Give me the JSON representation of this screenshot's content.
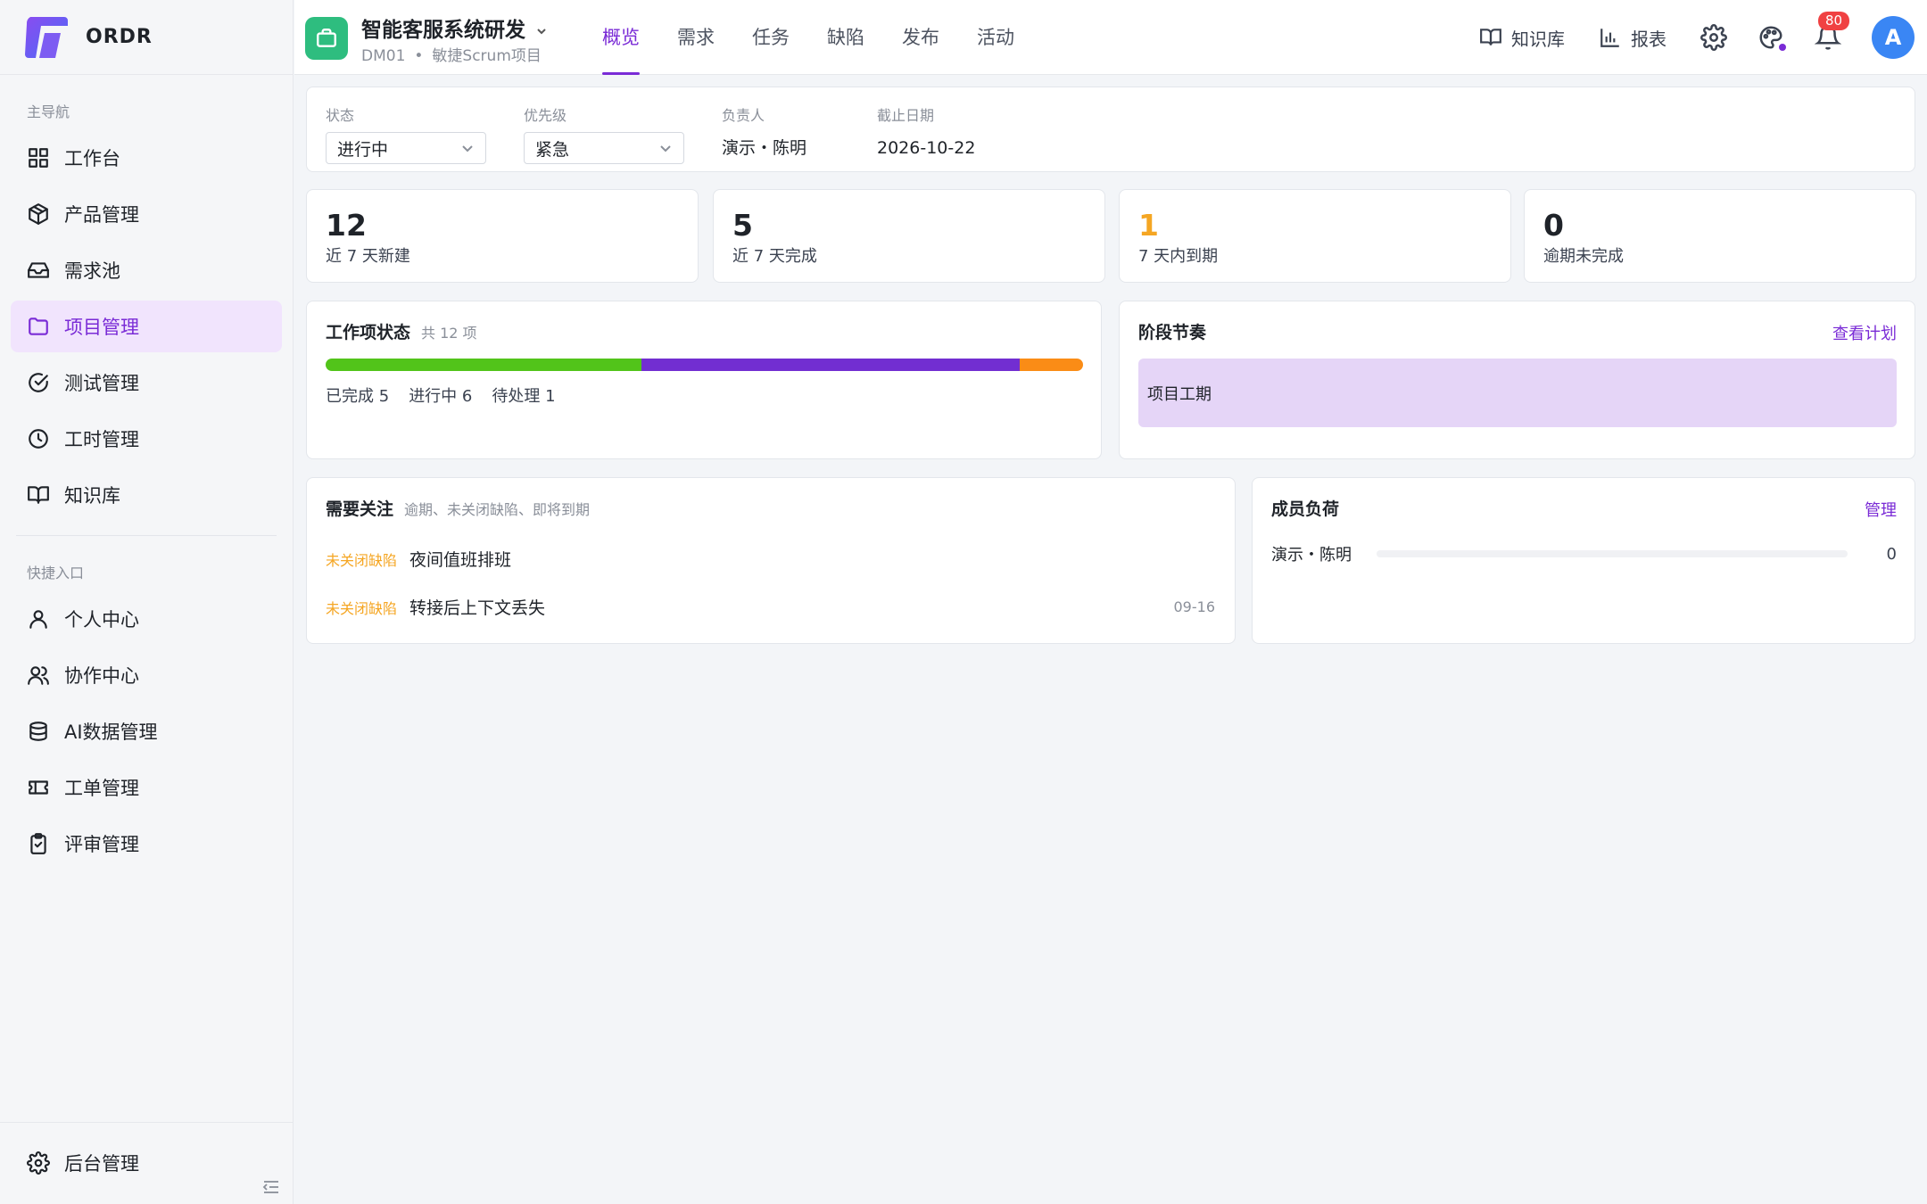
{
  "brand": {
    "name": "ORDR"
  },
  "sidebar": {
    "main_title": "主导航",
    "main_items": [
      {
        "label": "工作台",
        "icon": "grid-icon"
      },
      {
        "label": "产品管理",
        "icon": "box-icon"
      },
      {
        "label": "需求池",
        "icon": "inbox-icon"
      },
      {
        "label": "项目管理",
        "icon": "folder-icon",
        "active": true
      },
      {
        "label": "测试管理",
        "icon": "check-circle-icon"
      },
      {
        "label": "工时管理",
        "icon": "clock-icon"
      },
      {
        "label": "知识库",
        "icon": "book-icon"
      }
    ],
    "quick_title": "快捷入口",
    "quick_items": [
      {
        "label": "个人中心",
        "icon": "user-icon"
      },
      {
        "label": "协作中心",
        "icon": "users-icon"
      },
      {
        "label": "AI数据管理",
        "icon": "database-icon"
      },
      {
        "label": "工单管理",
        "icon": "ticket-icon"
      },
      {
        "label": "评审管理",
        "icon": "clipboard-icon"
      }
    ],
    "bottom_item": {
      "label": "后台管理",
      "icon": "gear-icon"
    }
  },
  "header": {
    "project_title": "智能客服系统研发",
    "project_code": "DM01",
    "project_type": "敏捷Scrum项目",
    "tabs": [
      {
        "label": "概览",
        "active": true
      },
      {
        "label": "需求"
      },
      {
        "label": "任务"
      },
      {
        "label": "缺陷"
      },
      {
        "label": "发布"
      },
      {
        "label": "活动"
      }
    ],
    "knowledge_label": "知识库",
    "report_label": "报表",
    "notification_count": "80",
    "avatar_initial": "A"
  },
  "filters": {
    "status": {
      "label": "状态",
      "value": "进行中"
    },
    "priority": {
      "label": "优先级",
      "value": "紧急"
    },
    "owner": {
      "label": "负责人",
      "value": "演示・陈明"
    },
    "due": {
      "label": "截止日期",
      "value": "2026-10-22"
    }
  },
  "stats": [
    {
      "value": "12",
      "label": "近 7 天新建"
    },
    {
      "value": "5",
      "label": "近 7 天完成"
    },
    {
      "value": "1",
      "label": "7 天内到期",
      "warn": true
    },
    {
      "value": "0",
      "label": "逾期未完成"
    }
  ],
  "work_status": {
    "title": "工作项状态",
    "subtitle": "共 12 项",
    "segments": [
      {
        "label": "已完成 5",
        "count": 5,
        "color": "#52c41a"
      },
      {
        "label": "进行中 6",
        "count": 6,
        "color": "#722ed1"
      },
      {
        "label": "待处理 1",
        "count": 1,
        "color": "#fa8c16"
      }
    ]
  },
  "phase": {
    "title": "阶段节奏",
    "link": "查看计划",
    "bar_label": "项目工期"
  },
  "attention": {
    "title": "需要关注",
    "subtitle": "逾期、未关闭缺陷、即将到期",
    "items": [
      {
        "tag": "未关闭缺陷",
        "text": "夜间值班排班",
        "date": ""
      },
      {
        "tag": "未关闭缺陷",
        "text": "转接后上下文丢失",
        "date": "09-16"
      }
    ]
  },
  "members": {
    "title": "成员负荷",
    "link": "管理",
    "rows": [
      {
        "name": "演示・陈明",
        "value": "0",
        "load": 0
      }
    ]
  },
  "colors": {
    "accent": "#7a2bd6",
    "project_icon": "#2ebd7f",
    "warn": "#f5a623",
    "badge": "#f04142",
    "avatar": "#3a86f4"
  }
}
